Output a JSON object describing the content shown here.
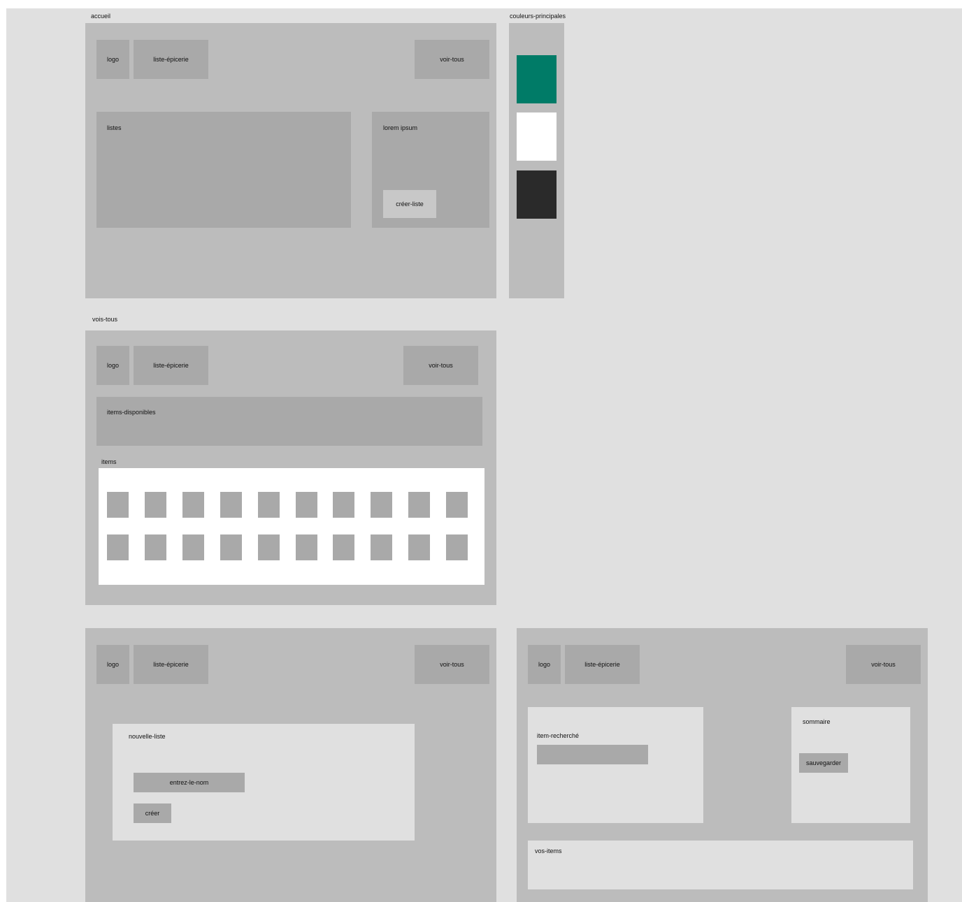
{
  "frames": {
    "accueil": {
      "title": "accueil",
      "logo": "logo",
      "app_name": "liste-épicerie",
      "see_all": "voir-tous",
      "lists_label": "listes",
      "side_text": "lorem ipsum",
      "create_list": "créer-liste"
    },
    "colors": {
      "title": "couleurs-principales",
      "swatches": [
        "#007b67",
        "#ffffff",
        "#2a2a2a"
      ]
    },
    "vois_tous": {
      "title": "vois-tous",
      "logo": "logo",
      "app_name": "liste-épicerie",
      "see_all": "voir-tous",
      "available_label": "items-disponibles",
      "items_label": "items",
      "grid": {
        "rows": 2,
        "cols": 10
      }
    },
    "nouvelle": {
      "logo": "logo",
      "app_name": "liste-épicerie",
      "see_all": "voir-tous",
      "dialog_title": "nouvelle-liste",
      "name_input": "entrez-le-nom",
      "create_button": "créer"
    },
    "recherche": {
      "logo": "logo",
      "app_name": "liste-épicerie",
      "see_all": "voir-tous",
      "searched_label": "item-recherché",
      "summary_label": "sommaire",
      "save_button": "sauvegarder",
      "your_items": "vos-items"
    }
  }
}
